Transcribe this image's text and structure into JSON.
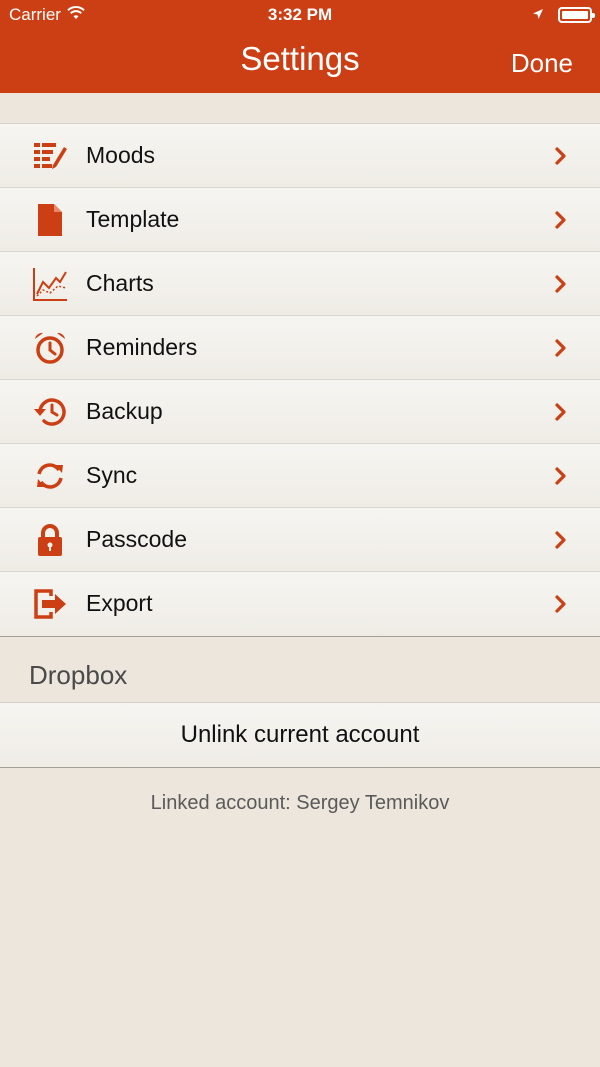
{
  "status_bar": {
    "carrier": "Carrier",
    "time": "3:32 PM"
  },
  "nav": {
    "title": "Settings",
    "done_label": "Done"
  },
  "colors": {
    "accent": "#cc3f14",
    "background": "#ece6dc"
  },
  "settings": {
    "items": [
      {
        "label": "Moods",
        "icon": "moods-list-icon"
      },
      {
        "label": "Template",
        "icon": "document-icon"
      },
      {
        "label": "Charts",
        "icon": "line-chart-icon"
      },
      {
        "label": "Reminders",
        "icon": "alarm-clock-icon"
      },
      {
        "label": "Backup",
        "icon": "history-icon"
      },
      {
        "label": "Sync",
        "icon": "sync-icon"
      },
      {
        "label": "Passcode",
        "icon": "lock-icon"
      },
      {
        "label": "Export",
        "icon": "export-icon"
      }
    ]
  },
  "dropbox": {
    "section_title": "Dropbox",
    "unlink_label": "Unlink current account",
    "linked_account_text": "Linked account: Sergey Temnikov"
  }
}
